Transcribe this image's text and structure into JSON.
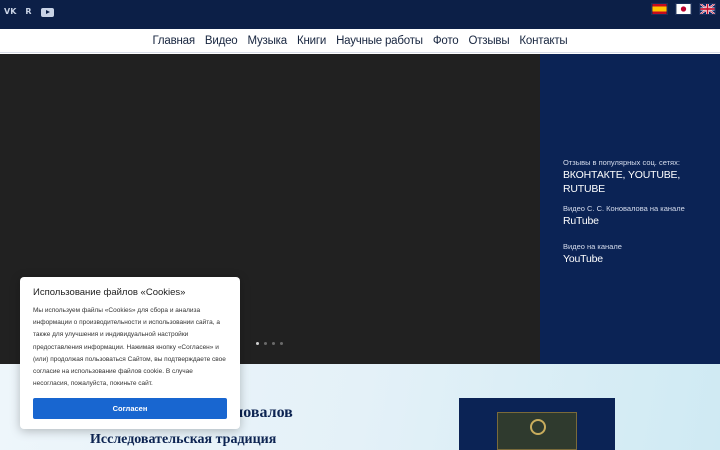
{
  "social": {
    "vk": "VK",
    "rutube": "R",
    "youtube_icon": "youtube-icon"
  },
  "flags": [
    "spain-flag",
    "japan-flag",
    "uk-flag"
  ],
  "nav": [
    "Главная",
    "Видео",
    "Музыка",
    "Книги",
    "Научные работы",
    "Фото",
    "Отзывы",
    "Контакты"
  ],
  "side": {
    "block1_small": "Отзывы в популярных соц. сетях:",
    "block1_big": "ВКОНТАКТЕ, YOUTUBE, RUTUBE",
    "block2_small": "Видео С. С. Коновалова на канале",
    "block2_big": "RuTube",
    "block3_small": "Видео на канале",
    "block3_big": "YouTube"
  },
  "slider": {
    "dot_count": 4,
    "active_index": 0
  },
  "lower": {
    "name_fragment": "оновалов",
    "tradition": "Исследовательская традиция"
  },
  "cookie": {
    "title": "Использование файлов «Cookies»",
    "text": "Мы используем файлы «Cookies» для сбора и анализа информации о производительности и использовании сайта, а также для улучшения и индивидуальной настройки предоставления информации. Нажимая кнопку «Согласен» и (или) продолжая пользоваться Сайтом, вы подтверждаете свое согласие на использование файлов cookie. В случае несогласия, пожалуйста, покиньте сайт.",
    "button": "Согласен"
  },
  "colors": {
    "header_bg": "#0c1f47",
    "side_bg": "#0b2355",
    "video_bg": "#212121",
    "button_blue": "#1866d0"
  }
}
